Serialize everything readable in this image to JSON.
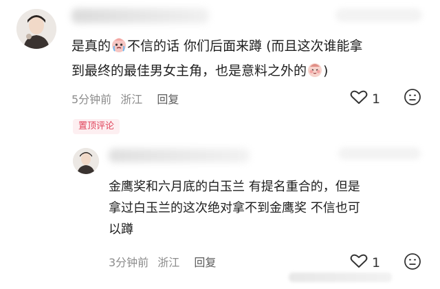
{
  "colors": {
    "pin_bg": "#fdeff1",
    "pin_text": "#e0435a",
    "meta": "#8c8c8c"
  },
  "comment": {
    "avatar_icon": "user-avatar-photo",
    "text_part1": "是真的",
    "text_part2": "不信的话 你们后面来蹲 (而且这次谁能拿",
    "text_line2": "到最终的最佳男女主角，也是意料之外的",
    "text_end": ")",
    "time": "5分钟前",
    "location": "浙江",
    "reply_label": "回复",
    "likes": "1",
    "pin_label": "置顶评论"
  },
  "reply": {
    "avatar_icon": "user-avatar-photo",
    "line1": "金鹰奖和六月底的白玉兰 有提名重合的，但是",
    "line2": "拿过白玉兰的这次绝对拿不到金鹰奖 不信也可",
    "line3": "以蹲",
    "time": "3分钟前",
    "location": "浙江",
    "reply_label": "回复",
    "likes": "1"
  }
}
